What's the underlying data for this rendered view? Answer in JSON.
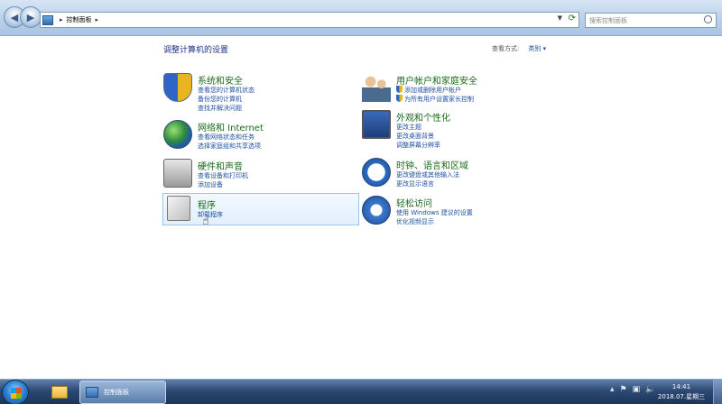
{
  "address_bar": {
    "crumbs": [
      "控制面板"
    ],
    "separator": "▸"
  },
  "search": {
    "placeholder": "搜索控制面板"
  },
  "main": {
    "title": "调整计算机的设置",
    "view_by_label": "查看方式:",
    "view_by_value": "类别 ▾"
  },
  "categories": [
    {
      "heading": "系统和安全",
      "icon": "security-shield-icon",
      "links": [
        "查看您的计算机状态",
        "备份您的计算机",
        "查找并解决问题"
      ]
    },
    {
      "heading": "网络和 Internet",
      "icon": "network-globe-icon",
      "links": [
        "查看网络状态和任务",
        "选择家庭组和共享选项"
      ]
    },
    {
      "heading": "硬件和声音",
      "icon": "printer-icon",
      "links": [
        "查看设备和打印机",
        "添加设备"
      ]
    },
    {
      "heading": "程序",
      "icon": "programs-icon",
      "links": [
        "卸载程序"
      ]
    },
    {
      "heading": "用户帐户和家庭安全",
      "icon": "users-icon",
      "links": [
        "添加或删除用户帐户",
        "为所有用户设置家长控制"
      ]
    },
    {
      "heading": "外观和个性化",
      "icon": "display-icon",
      "links": [
        "更改主题",
        "更改桌面背景",
        "调整屏幕分辨率"
      ]
    },
    {
      "heading": "时钟、语言和区域",
      "icon": "clock-globe-icon",
      "links": [
        "更改键盘或其他输入法",
        "更改显示语言"
      ]
    },
    {
      "heading": "轻松访问",
      "icon": "ease-of-access-icon",
      "links": [
        "使用 Windows 建议的设置",
        "优化视频显示"
      ]
    }
  ],
  "taskbar": {
    "active_app_label": "控制面板",
    "clock_time": "14:41",
    "clock_date": "2018.07.星期三"
  }
}
